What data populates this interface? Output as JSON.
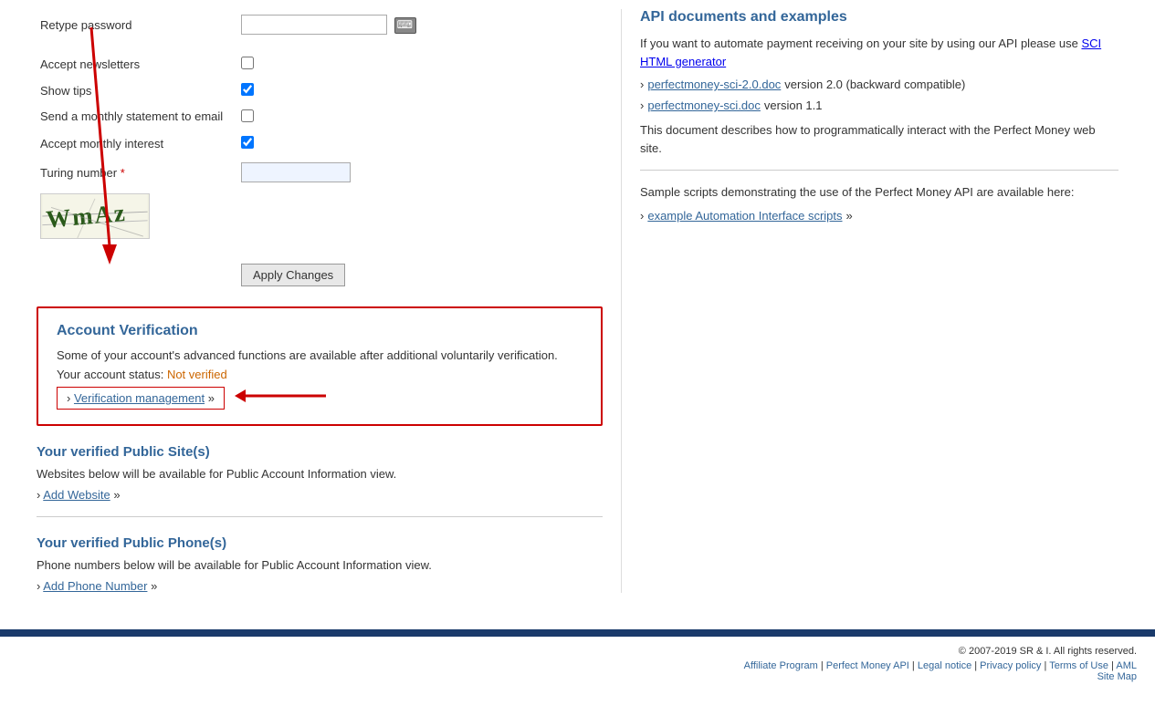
{
  "form": {
    "retype_password_label": "Retype password",
    "accept_newsletters_label": "Accept newsletters",
    "show_tips_label": "Show tips",
    "send_statement_label": "Send a monthly statement to email",
    "accept_interest_label": "Accept monthly interest",
    "turing_label": "Turing number",
    "turing_required": "*",
    "apply_button": "Apply Changes"
  },
  "verification": {
    "title": "Account Verification",
    "description": "Some of your account's advanced functions are available after additional voluntarily verification.",
    "status_label": "Your account status: ",
    "status_value": "Not verified",
    "link_prefix": "›",
    "link_text": "Verification management",
    "link_suffix": "»"
  },
  "public_sites": {
    "title": "Your verified Public Site(s)",
    "description": "Websites below will be available for Public Account Information view.",
    "link_prefix": "›",
    "link_text": "Add Website",
    "link_suffix": "»"
  },
  "public_phones": {
    "title": "Your verified Public Phone(s)",
    "description": "Phone numbers below will be available for Public Account Information view.",
    "link_prefix": "›",
    "link_text": "Add Phone Number",
    "link_suffix": "»"
  },
  "api": {
    "title": "API documents and examples",
    "description": "If you want to automate payment receiving on your site by using our API please use",
    "sci_link_text": "SCI HTML generator",
    "links": [
      {
        "text": "perfectmoney-sci-2.0.doc",
        "desc": "version 2.0 (backward compatible)"
      },
      {
        "text": "perfectmoney-sci.doc",
        "desc": "version 1.1"
      }
    ],
    "doc_description": "This document describes how to programmatically interact with the Perfect Money web site.",
    "sample_description": "Sample scripts demonstrating the use of the Perfect Money API are available here:",
    "example_link": "example Automation Interface scripts",
    "example_suffix": "»"
  },
  "footer": {
    "copy": "© 2007-2019 SR & I. All rights reserved.",
    "links": [
      "Affiliate Program",
      "Perfect Money API",
      "Legal notice",
      "Privacy policy",
      "Terms of Use",
      "AML",
      "Site Map"
    ]
  }
}
